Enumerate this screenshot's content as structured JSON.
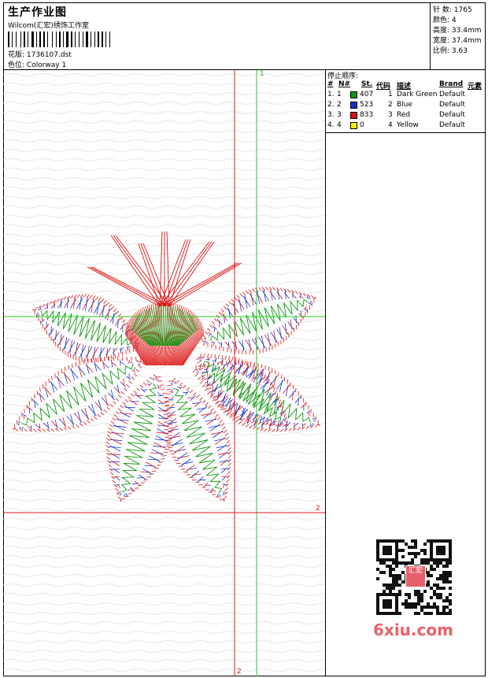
{
  "header": {
    "title": "生产作业图",
    "company": "Wilcom(汇宏)绣饰工作室",
    "design_label": "花版:",
    "design_value": "1736107.dst",
    "colorway_label": "色位:",
    "colorway_value": "Colorway 1"
  },
  "stats": [
    {
      "label": "针 数:",
      "value": "1765"
    },
    {
      "label": "颜色:",
      "value": "4"
    },
    {
      "label": "高度:",
      "value": "33.4mm"
    },
    {
      "label": "宽度:",
      "value": "37.4mm"
    },
    {
      "label": "比例:",
      "value": "3.63"
    }
  ],
  "stop_sequence": {
    "title": "停止顺序:",
    "columns": [
      "#",
      "N#",
      "St.",
      "代码",
      "描述",
      "Brand",
      "元素"
    ],
    "rows": [
      {
        "index": "1.",
        "n": "1",
        "color": "#119911",
        "stitches": "407",
        "code": "1",
        "desc": "Dark Green",
        "brand": "Default"
      },
      {
        "index": "2.",
        "n": "2",
        "color": "#1133cc",
        "stitches": "523",
        "code": "2",
        "desc": "Blue",
        "brand": "Default"
      },
      {
        "index": "3.",
        "n": "3",
        "color": "#dd1111",
        "stitches": "833",
        "code": "3",
        "desc": "Red",
        "brand": "Default"
      },
      {
        "index": "4.",
        "n": "4",
        "color": "#ffee00",
        "stitches": "0",
        "code": "4",
        "desc": "Yellow",
        "brand": "Default"
      }
    ]
  },
  "guides": {
    "v1_label": "1",
    "h2_label": "2",
    "v2_label": "2"
  },
  "watermark": {
    "text": "6xiu.com",
    "seal_text": "汇宏"
  },
  "colors": {
    "green": "#119911",
    "blue": "#1133cc",
    "red": "#dd1111",
    "guide_red": "#e01818",
    "guide_green": "#22cc22",
    "watermark": "#e8606a"
  }
}
